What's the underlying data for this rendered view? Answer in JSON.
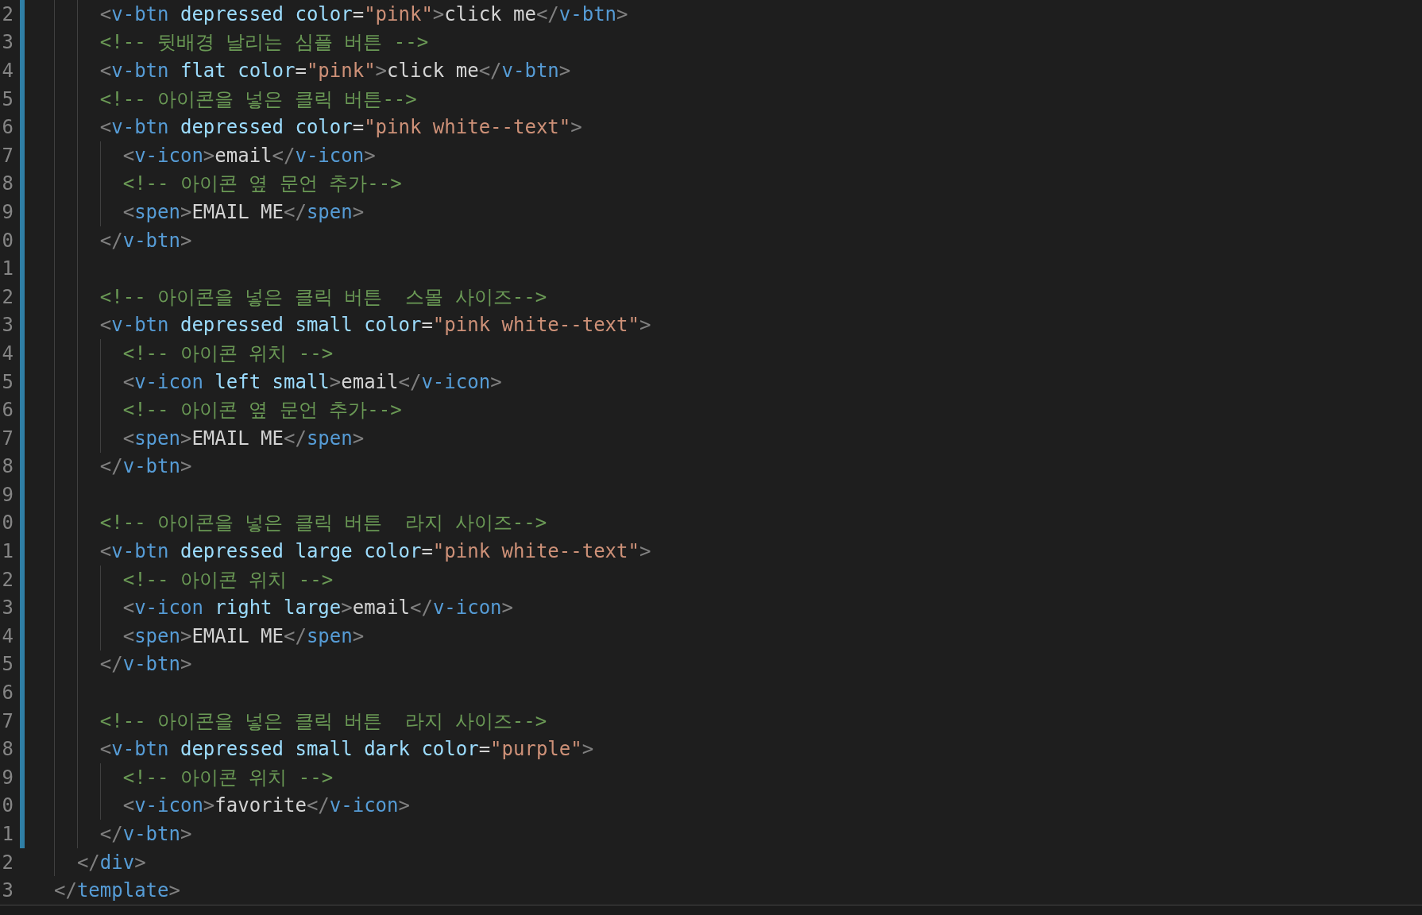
{
  "editor": {
    "lines": [
      {
        "number": "2",
        "modified": true,
        "tokens": [
          {
            "kind": "punct",
            "text": "    <"
          },
          {
            "kind": "tag",
            "text": "v-btn"
          },
          {
            "kind": "attr",
            "text": " depressed"
          },
          {
            "kind": "attr",
            "text": " color"
          },
          {
            "kind": "plain",
            "text": "="
          },
          {
            "kind": "string",
            "text": "\"pink\""
          },
          {
            "kind": "punct",
            "text": ">"
          },
          {
            "kind": "plain",
            "text": "click me"
          },
          {
            "kind": "punct",
            "text": "</"
          },
          {
            "kind": "tag",
            "text": "v-btn"
          },
          {
            "kind": "punct",
            "text": ">"
          }
        ]
      },
      {
        "number": "3",
        "modified": true,
        "tokens": [
          {
            "kind": "comment",
            "text": "    <!-- 뒷배경 날리는 심플 버튼 -->"
          }
        ]
      },
      {
        "number": "4",
        "modified": true,
        "tokens": [
          {
            "kind": "punct",
            "text": "    <"
          },
          {
            "kind": "tag",
            "text": "v-btn"
          },
          {
            "kind": "attr",
            "text": " flat"
          },
          {
            "kind": "attr",
            "text": " color"
          },
          {
            "kind": "plain",
            "text": "="
          },
          {
            "kind": "string",
            "text": "\"pink\""
          },
          {
            "kind": "punct",
            "text": ">"
          },
          {
            "kind": "plain",
            "text": "click me"
          },
          {
            "kind": "punct",
            "text": "</"
          },
          {
            "kind": "tag",
            "text": "v-btn"
          },
          {
            "kind": "punct",
            "text": ">"
          }
        ]
      },
      {
        "number": "5",
        "modified": true,
        "tokens": [
          {
            "kind": "comment",
            "text": "    <!-- 아이콘을 넣은 클릭 버튼-->"
          }
        ]
      },
      {
        "number": "6",
        "modified": true,
        "tokens": [
          {
            "kind": "punct",
            "text": "    <"
          },
          {
            "kind": "tag",
            "text": "v-btn"
          },
          {
            "kind": "attr",
            "text": " depressed"
          },
          {
            "kind": "attr",
            "text": " color"
          },
          {
            "kind": "plain",
            "text": "="
          },
          {
            "kind": "string",
            "text": "\"pink white--text\""
          },
          {
            "kind": "punct",
            "text": ">"
          }
        ]
      },
      {
        "number": "7",
        "modified": true,
        "tokens": [
          {
            "kind": "punct",
            "text": "      <"
          },
          {
            "kind": "tag",
            "text": "v-icon"
          },
          {
            "kind": "punct",
            "text": ">"
          },
          {
            "kind": "plain",
            "text": "email"
          },
          {
            "kind": "punct",
            "text": "</"
          },
          {
            "kind": "tag",
            "text": "v-icon"
          },
          {
            "kind": "punct",
            "text": ">"
          }
        ]
      },
      {
        "number": "8",
        "modified": true,
        "tokens": [
          {
            "kind": "comment",
            "text": "      <!-- 아이콘 옆 문언 추가-->"
          }
        ]
      },
      {
        "number": "9",
        "modified": true,
        "tokens": [
          {
            "kind": "punct",
            "text": "      <"
          },
          {
            "kind": "tag",
            "text": "spen"
          },
          {
            "kind": "punct",
            "text": ">"
          },
          {
            "kind": "plain",
            "text": "EMAIL ME"
          },
          {
            "kind": "punct",
            "text": "</"
          },
          {
            "kind": "tag",
            "text": "spen"
          },
          {
            "kind": "punct",
            "text": ">"
          }
        ]
      },
      {
        "number": "0",
        "modified": true,
        "tokens": [
          {
            "kind": "punct",
            "text": "    </"
          },
          {
            "kind": "tag",
            "text": "v-btn"
          },
          {
            "kind": "punct",
            "text": ">"
          }
        ]
      },
      {
        "number": "1",
        "modified": true
      },
      {
        "number": "2",
        "modified": true,
        "tokens": [
          {
            "kind": "comment",
            "text": "    <!-- 아이콘을 넣은 클릭 버튼  스몰 사이즈-->"
          }
        ]
      },
      {
        "number": "3",
        "modified": true,
        "tokens": [
          {
            "kind": "punct",
            "text": "    <"
          },
          {
            "kind": "tag",
            "text": "v-btn"
          },
          {
            "kind": "attr",
            "text": " depressed"
          },
          {
            "kind": "attr",
            "text": " small"
          },
          {
            "kind": "attr",
            "text": " color"
          },
          {
            "kind": "plain",
            "text": "="
          },
          {
            "kind": "string",
            "text": "\"pink white--text\""
          },
          {
            "kind": "punct",
            "text": ">"
          }
        ]
      },
      {
        "number": "4",
        "modified": true,
        "tokens": [
          {
            "kind": "comment",
            "text": "      <!-- 아이콘 위치 -->"
          }
        ]
      },
      {
        "number": "5",
        "modified": true,
        "tokens": [
          {
            "kind": "punct",
            "text": "      <"
          },
          {
            "kind": "tag",
            "text": "v-icon"
          },
          {
            "kind": "attr",
            "text": " left"
          },
          {
            "kind": "attr",
            "text": " small"
          },
          {
            "kind": "punct",
            "text": ">"
          },
          {
            "kind": "plain",
            "text": "email"
          },
          {
            "kind": "punct",
            "text": "</"
          },
          {
            "kind": "tag",
            "text": "v-icon"
          },
          {
            "kind": "punct",
            "text": ">"
          }
        ]
      },
      {
        "number": "6",
        "modified": true,
        "tokens": [
          {
            "kind": "comment",
            "text": "      <!-- 아이콘 옆 문언 추가-->"
          }
        ]
      },
      {
        "number": "7",
        "modified": true,
        "tokens": [
          {
            "kind": "punct",
            "text": "      <"
          },
          {
            "kind": "tag",
            "text": "spen"
          },
          {
            "kind": "punct",
            "text": ">"
          },
          {
            "kind": "plain",
            "text": "EMAIL ME"
          },
          {
            "kind": "punct",
            "text": "</"
          },
          {
            "kind": "tag",
            "text": "spen"
          },
          {
            "kind": "punct",
            "text": ">"
          }
        ]
      },
      {
        "number": "8",
        "modified": true,
        "tokens": [
          {
            "kind": "punct",
            "text": "    </"
          },
          {
            "kind": "tag",
            "text": "v-btn"
          },
          {
            "kind": "punct",
            "text": ">"
          }
        ]
      },
      {
        "number": "9",
        "modified": true
      },
      {
        "number": "0",
        "modified": true,
        "tokens": [
          {
            "kind": "comment",
            "text": "    <!-- 아이콘을 넣은 클릭 버튼  라지 사이즈-->"
          }
        ]
      },
      {
        "number": "1",
        "modified": true,
        "tokens": [
          {
            "kind": "punct",
            "text": "    <"
          },
          {
            "kind": "tag",
            "text": "v-btn"
          },
          {
            "kind": "attr",
            "text": " depressed"
          },
          {
            "kind": "attr",
            "text": " large"
          },
          {
            "kind": "attr",
            "text": " color"
          },
          {
            "kind": "plain",
            "text": "="
          },
          {
            "kind": "string",
            "text": "\"pink white--text\""
          },
          {
            "kind": "punct",
            "text": ">"
          }
        ]
      },
      {
        "number": "2",
        "modified": true,
        "tokens": [
          {
            "kind": "comment",
            "text": "      <!-- 아이콘 위치 -->"
          }
        ]
      },
      {
        "number": "3",
        "modified": true,
        "tokens": [
          {
            "kind": "punct",
            "text": "      <"
          },
          {
            "kind": "tag",
            "text": "v-icon"
          },
          {
            "kind": "attr",
            "text": " right"
          },
          {
            "kind": "attr",
            "text": " large"
          },
          {
            "kind": "punct",
            "text": ">"
          },
          {
            "kind": "plain",
            "text": "email"
          },
          {
            "kind": "punct",
            "text": "</"
          },
          {
            "kind": "tag",
            "text": "v-icon"
          },
          {
            "kind": "punct",
            "text": ">"
          }
        ]
      },
      {
        "number": "4",
        "modified": true,
        "tokens": [
          {
            "kind": "punct",
            "text": "      <"
          },
          {
            "kind": "tag",
            "text": "spen"
          },
          {
            "kind": "punct",
            "text": ">"
          },
          {
            "kind": "plain",
            "text": "EMAIL ME"
          },
          {
            "kind": "punct",
            "text": "</"
          },
          {
            "kind": "tag",
            "text": "spen"
          },
          {
            "kind": "punct",
            "text": ">"
          }
        ]
      },
      {
        "number": "5",
        "modified": true,
        "tokens": [
          {
            "kind": "punct",
            "text": "    </"
          },
          {
            "kind": "tag",
            "text": "v-btn"
          },
          {
            "kind": "punct",
            "text": ">"
          }
        ]
      },
      {
        "number": "6",
        "modified": true
      },
      {
        "number": "7",
        "modified": true,
        "tokens": [
          {
            "kind": "comment",
            "text": "    <!-- 아이콘을 넣은 클릭 버튼  라지 사이즈-->"
          }
        ]
      },
      {
        "number": "8",
        "modified": true,
        "tokens": [
          {
            "kind": "punct",
            "text": "    <"
          },
          {
            "kind": "tag",
            "text": "v-btn"
          },
          {
            "kind": "attr",
            "text": " depressed"
          },
          {
            "kind": "attr",
            "text": " small"
          },
          {
            "kind": "attr",
            "text": " dark"
          },
          {
            "kind": "attr",
            "text": " color"
          },
          {
            "kind": "plain",
            "text": "="
          },
          {
            "kind": "string",
            "text": "\"purple\""
          },
          {
            "kind": "punct",
            "text": ">"
          }
        ]
      },
      {
        "number": "9",
        "modified": true,
        "tokens": [
          {
            "kind": "comment",
            "text": "      <!-- 아이콘 위치 -->"
          }
        ]
      },
      {
        "number": "0",
        "modified": true,
        "tokens": [
          {
            "kind": "punct",
            "text": "      <"
          },
          {
            "kind": "tag",
            "text": "v-icon"
          },
          {
            "kind": "punct",
            "text": ">"
          },
          {
            "kind": "plain",
            "text": "favorite"
          },
          {
            "kind": "punct",
            "text": "</"
          },
          {
            "kind": "tag",
            "text": "v-icon"
          },
          {
            "kind": "punct",
            "text": ">"
          }
        ]
      },
      {
        "number": "1",
        "modified": true,
        "tokens": [
          {
            "kind": "punct",
            "text": "    </"
          },
          {
            "kind": "tag",
            "text": "v-btn"
          },
          {
            "kind": "punct",
            "text": ">"
          }
        ]
      },
      {
        "number": "2",
        "modified": false,
        "tokens": [
          {
            "kind": "punct",
            "text": "  </"
          },
          {
            "kind": "tag",
            "text": "div"
          },
          {
            "kind": "punct",
            "text": ">"
          }
        ]
      },
      {
        "number": "3",
        "modified": false,
        "tokens": [
          {
            "kind": "punct",
            "text": "</"
          },
          {
            "kind": "tag",
            "text": "template"
          },
          {
            "kind": "punct",
            "text": ">"
          }
        ]
      }
    ]
  }
}
